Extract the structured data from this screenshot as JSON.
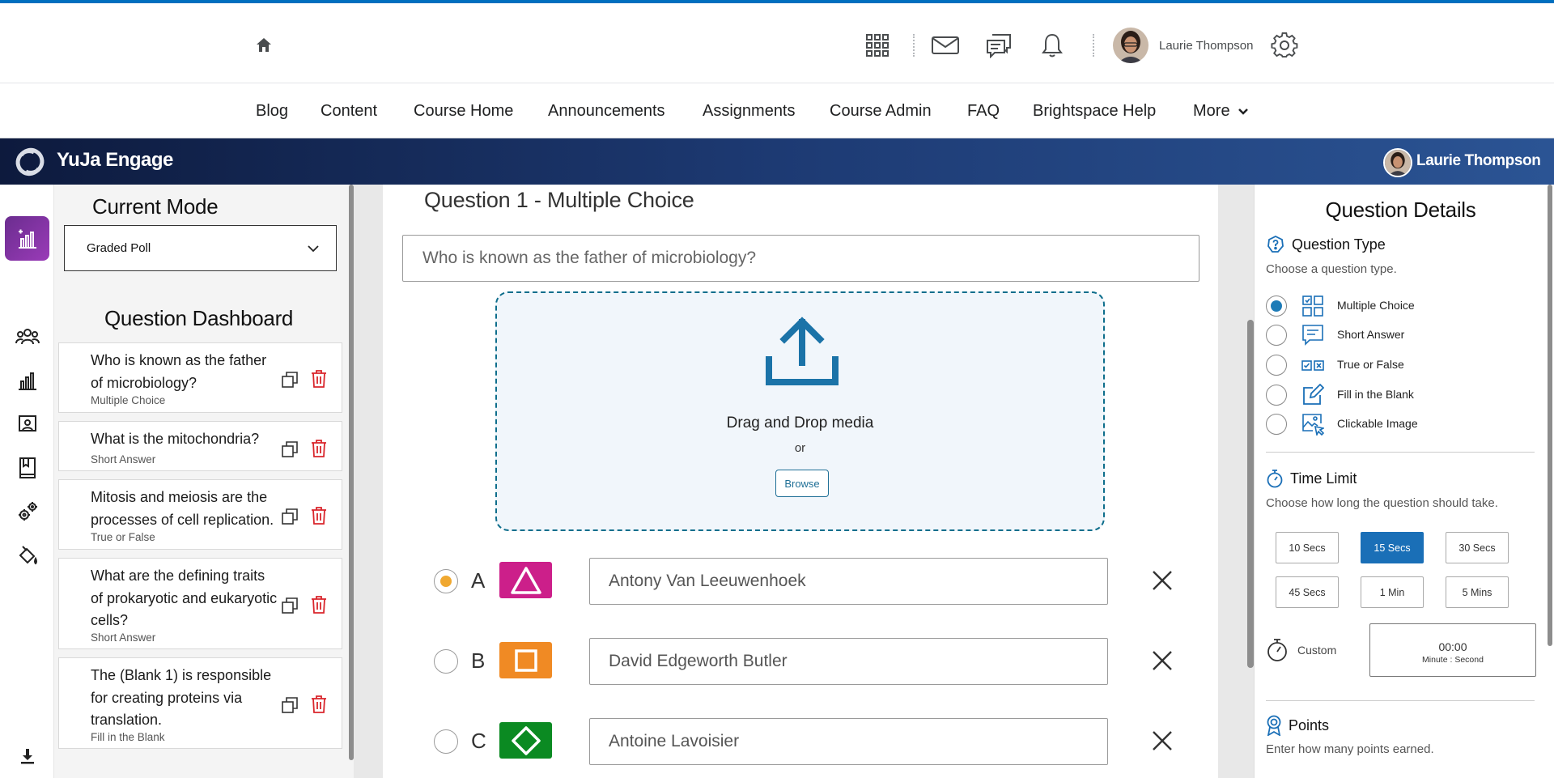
{
  "topbar": {
    "user_name": "Laurie Thompson"
  },
  "nav": {
    "items": [
      "Blog",
      "Content",
      "Course Home",
      "Announcements",
      "Assignments",
      "Course Admin",
      "FAQ",
      "Brightspace Help",
      "More"
    ]
  },
  "yuja": {
    "title": "YuJa Engage",
    "user_name": "Laurie Thompson"
  },
  "left_panel": {
    "mode_title": "Current Mode",
    "mode_value": "Graded Poll",
    "dashboard_title": "Question Dashboard",
    "questions": [
      {
        "text": "Who is known as the father of microbiology?",
        "type": "Multiple Choice"
      },
      {
        "text": "What is the mitochondria?",
        "type": "Short Answer"
      },
      {
        "text": "Mitosis and meiosis are the processes of cell replication.",
        "type": "True or False"
      },
      {
        "text": "What are the defining traits of prokaryotic and eukaryotic cells?",
        "type": "Short Answer"
      },
      {
        "text": "The (Blank 1) is responsible for creating proteins via translation.",
        "type": "Fill in the Blank"
      }
    ]
  },
  "editor": {
    "heading": "Question 1 - Multiple Choice",
    "question_text": "Who is known as the father of microbiology?",
    "dropzone_title": "Drag and Drop media",
    "dropzone_or": "or",
    "browse_label": "Browse",
    "answers": [
      {
        "letter": "A",
        "text": "Antony Van Leeuwenhoek",
        "selected": true,
        "shape": "triangle-icon",
        "color": "#cc1f8a"
      },
      {
        "letter": "B",
        "text": "David Edgeworth Butler",
        "selected": false,
        "shape": "square-icon",
        "color": "#f08a24"
      },
      {
        "letter": "C",
        "text": "Antoine Lavoisier",
        "selected": false,
        "shape": "diamond-icon",
        "color": "#0b8a22"
      }
    ]
  },
  "details": {
    "title": "Question Details",
    "question_type_label": "Question Type",
    "question_type_hint": "Choose a question type.",
    "types": [
      {
        "label": "Multiple Choice",
        "selected": true
      },
      {
        "label": "Short Answer",
        "selected": false
      },
      {
        "label": "True or False",
        "selected": false
      },
      {
        "label": "Fill in the Blank",
        "selected": false
      },
      {
        "label": "Clickable Image",
        "selected": false
      }
    ],
    "time_limit_label": "Time Limit",
    "time_limit_hint": "Choose how long the question should take.",
    "time_options": [
      "10 Secs",
      "15 Secs",
      "30 Secs",
      "45 Secs",
      "1 Min",
      "5 Mins"
    ],
    "time_selected": "15 Secs",
    "custom_label": "Custom",
    "custom_time": "00:00",
    "custom_time_sub": "Minute : Second",
    "points_label": "Points",
    "points_hint": "Enter how many points earned."
  },
  "colors": {
    "accent": "#1a6fb7",
    "active_rail": "#7b2fa0",
    "delete": "#d9262c",
    "header_dark": "#0d1a3d"
  }
}
